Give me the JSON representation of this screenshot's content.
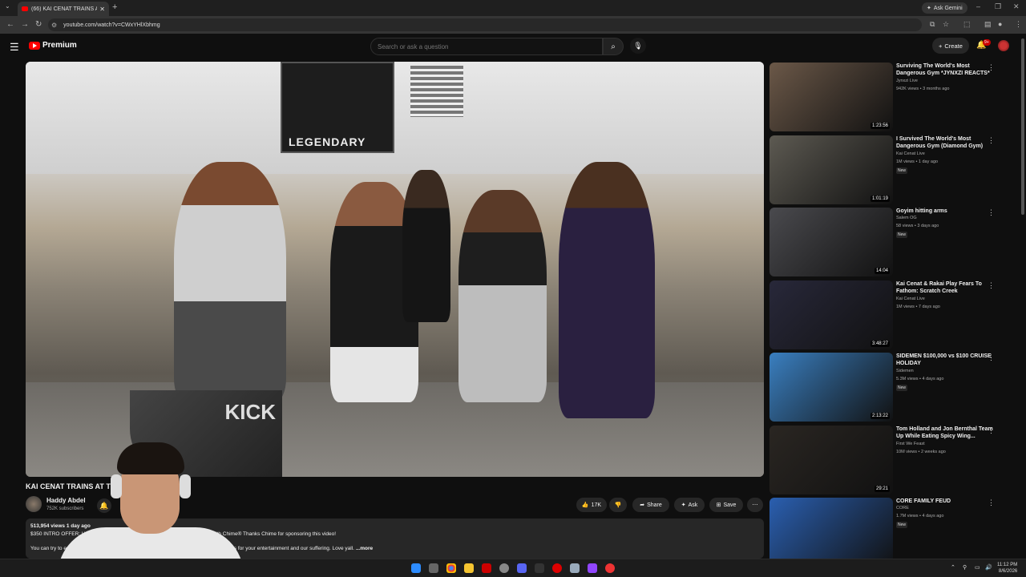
{
  "browser": {
    "tab_title": "(66) KAI CENAT TRAINS AT",
    "url": "youtube.com/watch?v=CWxYHlXbhmg",
    "ask_gemini": "Ask Gemini"
  },
  "header": {
    "logo_text": "Premium",
    "search_placeholder": "Search or ask a question",
    "create_label": "Create",
    "notif_badge": "9+"
  },
  "video": {
    "banner_text": "LEGENDARY",
    "pip_text": "KICK",
    "title": "KAI CENAT TRAINS AT T                                  GYM IN AMERICA",
    "channel_name": "Haddy Abdel",
    "channel_subs": "752K subscribers",
    "likes": "17K",
    "share_label": "Share",
    "ask_label": "Ask",
    "save_label": "Save",
    "views_date": "513,954 views  1 day ago",
    "desc_line1": "$350 INTRO OFFER: Head to https                                    for up to $350 and 3.75% APY on savings with Chime® Thanks Chime for sponsoring this video!",
    "desc_line2": "You can try to em                                     don't recommend anyone try any of the stunts seen in the video. This is for your entertainment and our suffering. Love yall.",
    "more_label": "...more"
  },
  "recommendations": [
    {
      "title": "Surviving The World's Most Dangerous Gym *JYNXZI REACTS*",
      "channel": "Jynxzi Live",
      "views": "942K views • 3 months ago",
      "duration": "1:23:56",
      "badge": "",
      "color": "#6b5848"
    },
    {
      "title": "I Survived The World's Most Dangerous Gym (Diamond Gym)",
      "channel": "Kai Cenat Live",
      "views": "1M views • 1 day ago",
      "duration": "1:01:19",
      "badge": "New",
      "color": "#5d5a52"
    },
    {
      "title": "Goyim hitting arms",
      "channel": "Salem OG",
      "views": "58 views • 3 days ago",
      "duration": "14:04",
      "badge": "New",
      "color": "#4a4a4e"
    },
    {
      "title": "Kai Cenat & Rakai Play Fears To Fathom: Scratch Creek",
      "channel": "Kai Cenat Live",
      "views": "1M views • 7 days ago",
      "duration": "3:48:27",
      "badge": "",
      "color": "#28283a"
    },
    {
      "title": "SIDEMEN $100,000 vs $100 CRUISE HOLIDAY",
      "channel": "Sidemen",
      "views": "5.3M views • 4 days ago",
      "duration": "2:13:22",
      "badge": "New",
      "color": "#3a7fc0"
    },
    {
      "title": "Tom Holland and Jon Bernthal Team Up While Eating Spicy Wing...",
      "channel": "First We Feast",
      "views": "10M views • 2 weeks ago",
      "duration": "29:21",
      "badge": "",
      "color": "#2a2622"
    },
    {
      "title": "CORE FAMILY FEUD",
      "channel": "CORE",
      "views": "1.7M views • 4 days ago",
      "duration": "",
      "badge": "New",
      "color": "#2a5fb0"
    }
  ],
  "taskbar": {
    "time": "11:12 PM",
    "date": "8/6/2026"
  }
}
